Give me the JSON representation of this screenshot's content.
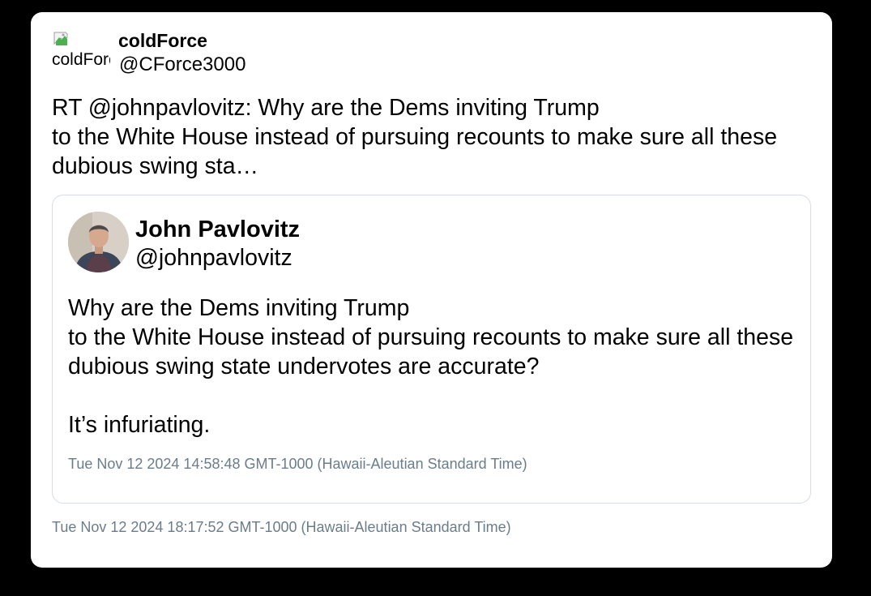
{
  "tweet": {
    "author": {
      "name": "coldForce",
      "handle": "@CForce3000",
      "avatar_alt": "coldForce",
      "avatar_icon": "broken-image-icon"
    },
    "text": "RT @johnpavlovitz: Why are the Dems inviting Trump\nto the White House instead of pursuing recounts to make sure all these dubious swing sta…",
    "timestamp": "Tue Nov 12 2024 18:17:52 GMT-1000 (Hawaii-Aleutian Standard Time)"
  },
  "quoted_tweet": {
    "author": {
      "name": "John Pavlovitz",
      "handle": "@johnpavlovitz"
    },
    "text": "Why are the Dems inviting Trump\nto the White House instead of pursuing recounts to make sure all these dubious swing state undervotes are accurate?\n\nIt’s infuriating.",
    "timestamp": "Tue Nov 12 2024 14:58:48 GMT-1000 (Hawaii-Aleutian Standard Time)"
  },
  "colors": {
    "background": "#000000",
    "card": "#ffffff",
    "timestamp": "#6b7d8a",
    "quote_border": "#d7dde2"
  }
}
